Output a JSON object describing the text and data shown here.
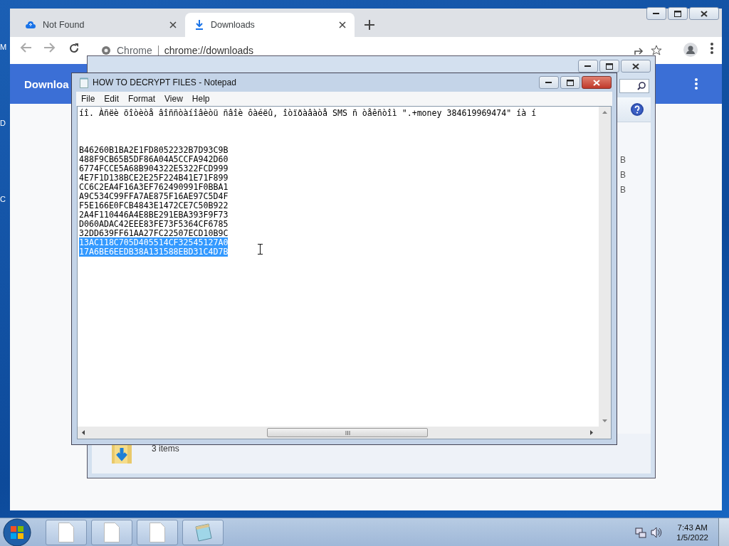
{
  "desktop": {
    "icon_labels": [
      "M",
      "D",
      "C"
    ]
  },
  "chrome": {
    "tabs": [
      {
        "title": "Not Found",
        "selected": false,
        "kind": "cloud"
      },
      {
        "title": "Downloads",
        "selected": true,
        "kind": "download"
      }
    ],
    "site_label": "Chrome",
    "url": "chrome://downloads",
    "page_title": "Downloa"
  },
  "explorer": {
    "size_cells": [
      "B",
      "B",
      "B"
    ],
    "status": "3 items"
  },
  "notepad": {
    "title": "HOW TO DECRYPT FILES - Notepad",
    "menu": [
      "File",
      "Edit",
      "Format",
      "View",
      "Help"
    ],
    "message": "íî. Àñëè õîòèòå âîññòàíîâèòü ñâîè ôàéëû, îòïðàâàòå SMS ñ òåêñòîì \".+money 384619969474\" íà í",
    "codes": [
      {
        "text": "B46260B1BA2E1FD8052232B7D93C9B",
        "selected": false
      },
      {
        "text": "488F9CB65B5DF86A04A5CCFA942D60",
        "selected": false
      },
      {
        "text": "6774FCCE5A68B904322E5322FCD999",
        "selected": false
      },
      {
        "text": "4E7F1D138BCE2E25F224B41E71F899",
        "selected": false
      },
      {
        "text": "CC6C2EA4F16A3EF762490991F0BBA1",
        "selected": false
      },
      {
        "text": "A9C534C99FFA7AE875F16AE97C5D4F",
        "selected": false
      },
      {
        "text": "F5E166E0FCB4843E1472CE7C50B922",
        "selected": false
      },
      {
        "text": "2A4F110446A4E8BE291EBA393F9F73",
        "selected": false
      },
      {
        "text": "D060ADAC42EEE83FE73F5364CF6785",
        "selected": false
      },
      {
        "text": "32DD639FF61AA27FC22507ECD10B9C",
        "selected": false
      },
      {
        "text": "13AC118C705D405514CF32545127A0",
        "selected": true
      },
      {
        "text": "17A6BE6EEDB38A131588EBD31C4D7B",
        "selected": true
      }
    ]
  },
  "taskbar": {
    "buttons": [
      {
        "kind": "document"
      },
      {
        "kind": "document"
      },
      {
        "kind": "document"
      },
      {
        "kind": "notepad"
      }
    ],
    "time": "7:43 AM",
    "date": "1/5/2022"
  }
}
